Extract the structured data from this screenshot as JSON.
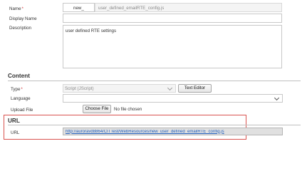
{
  "general": {
    "name_label": "Name",
    "required_mark": "*",
    "name_prefix": "new_",
    "name_value": "user_defined_emailRTE_config.js",
    "display_name_label": "Display Name",
    "display_name_value": "",
    "description_label": "Description",
    "description_value": "user defined RTE settings"
  },
  "content": {
    "section_title": "Content",
    "type_label": "Type",
    "type_value": "Script (JScript)",
    "text_editor_label": "Text Editor",
    "language_label": "Language",
    "language_value": "",
    "upload_file_label": "Upload File",
    "choose_file_label": "Choose File",
    "no_file_label": "No file chosen"
  },
  "url_section": {
    "section_title": "URL",
    "url_label": "URL",
    "url_value": "http://auroravd8864/CITTest/WebResources/new_user_defined_emailRTE_config.js"
  },
  "colors": {
    "highlight_border": "#d9534f",
    "link": "#1f5fbf",
    "required": "#d13438"
  }
}
